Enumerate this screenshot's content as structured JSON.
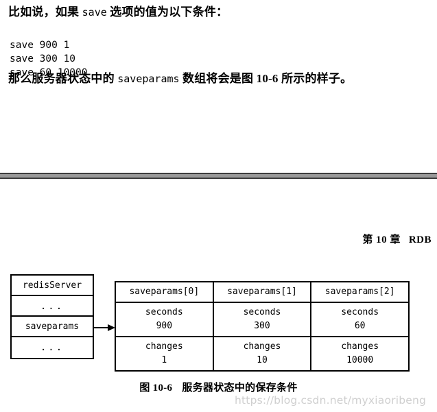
{
  "page_top": {
    "paragraph_1_prefix": "比如说，如果 ",
    "paragraph_1_mono": "save",
    "paragraph_1_suffix": " 选项的值为以下条件：",
    "code_block": "save 900 1\nsave 300 10\nsave 60 10000",
    "paragraph_2_prefix": "那么服务器状态中的 ",
    "paragraph_2_mono": "saveparams",
    "paragraph_2_suffix": " 数组将会是图 10-6 所示的样子。"
  },
  "page_bottom": {
    "running_head_chapter": "第 10 章",
    "running_head_title": "RDB"
  },
  "figure": {
    "struct_box": {
      "rows": [
        {
          "label": "redisServer"
        },
        {
          "label": "..."
        },
        {
          "label": "saveparams"
        },
        {
          "label": "..."
        }
      ]
    },
    "array_table": {
      "headers": [
        "saveparams[0]",
        "saveparams[1]",
        "saveparams[2]"
      ],
      "rows": [
        {
          "field": "seconds",
          "values": [
            "900",
            "300",
            "60"
          ]
        },
        {
          "field": "changes",
          "values": [
            "1",
            "10",
            "10000"
          ]
        }
      ]
    },
    "caption_number": "图 10-6",
    "caption_text": "服务器状态中的保存条件"
  },
  "watermark": {
    "text": "https://blog.csdn.net/myxiaoribeng"
  },
  "colors": {
    "separator_fill": "#9a9a9a",
    "separator_edge": "#3d3d3d",
    "ink": "#000000",
    "watermark": "#cfcfcf"
  }
}
